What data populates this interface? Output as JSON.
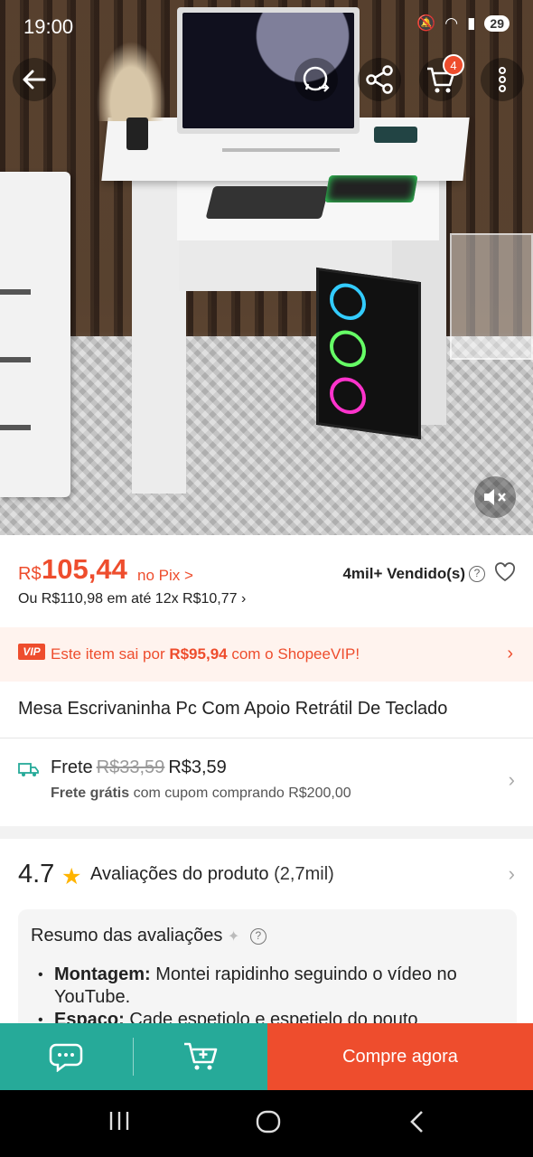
{
  "status_bar": {
    "time": "19:00",
    "battery": "29"
  },
  "header": {
    "cart_count": "4"
  },
  "price": {
    "currency": "R$",
    "value": "105,44",
    "pix_label": "no Pix >",
    "sold": "4mil+ Vendido(s)",
    "installments": "Ou R$110,98 em até 12x R$10,77 ›"
  },
  "vip": {
    "badge": "VIP",
    "text_before": "Este item sai por ",
    "amount": "R$95,94",
    "text_after": " com o ShopeeVIP!"
  },
  "product": {
    "title": "Mesa Escrivaninha Pc Com Apoio Retrátil De Teclado"
  },
  "shipping": {
    "label": "Frete",
    "old_price": "R$33,59",
    "new_price": "R$3,59",
    "free_bold": "Frete grátis",
    "free_rest": " com cupom comprando R$200,00"
  },
  "reviews": {
    "rating": "4.7",
    "label": "Avaliações do produto",
    "count": "(2,7mil)",
    "summary_title": "Resumo das avaliações",
    "items": [
      {
        "topic": "Montagem:",
        "text": " Montei rapidinho seguindo o vídeo no YouTube."
      },
      {
        "topic": "Espaço:",
        "text": " Cade espetiolo e espetielo do pouto"
      }
    ]
  },
  "actions": {
    "buy_label": "Compre agora"
  },
  "colors": {
    "brand": "#ee4d2d",
    "teal": "#26aa99",
    "star": "#ffb400"
  }
}
